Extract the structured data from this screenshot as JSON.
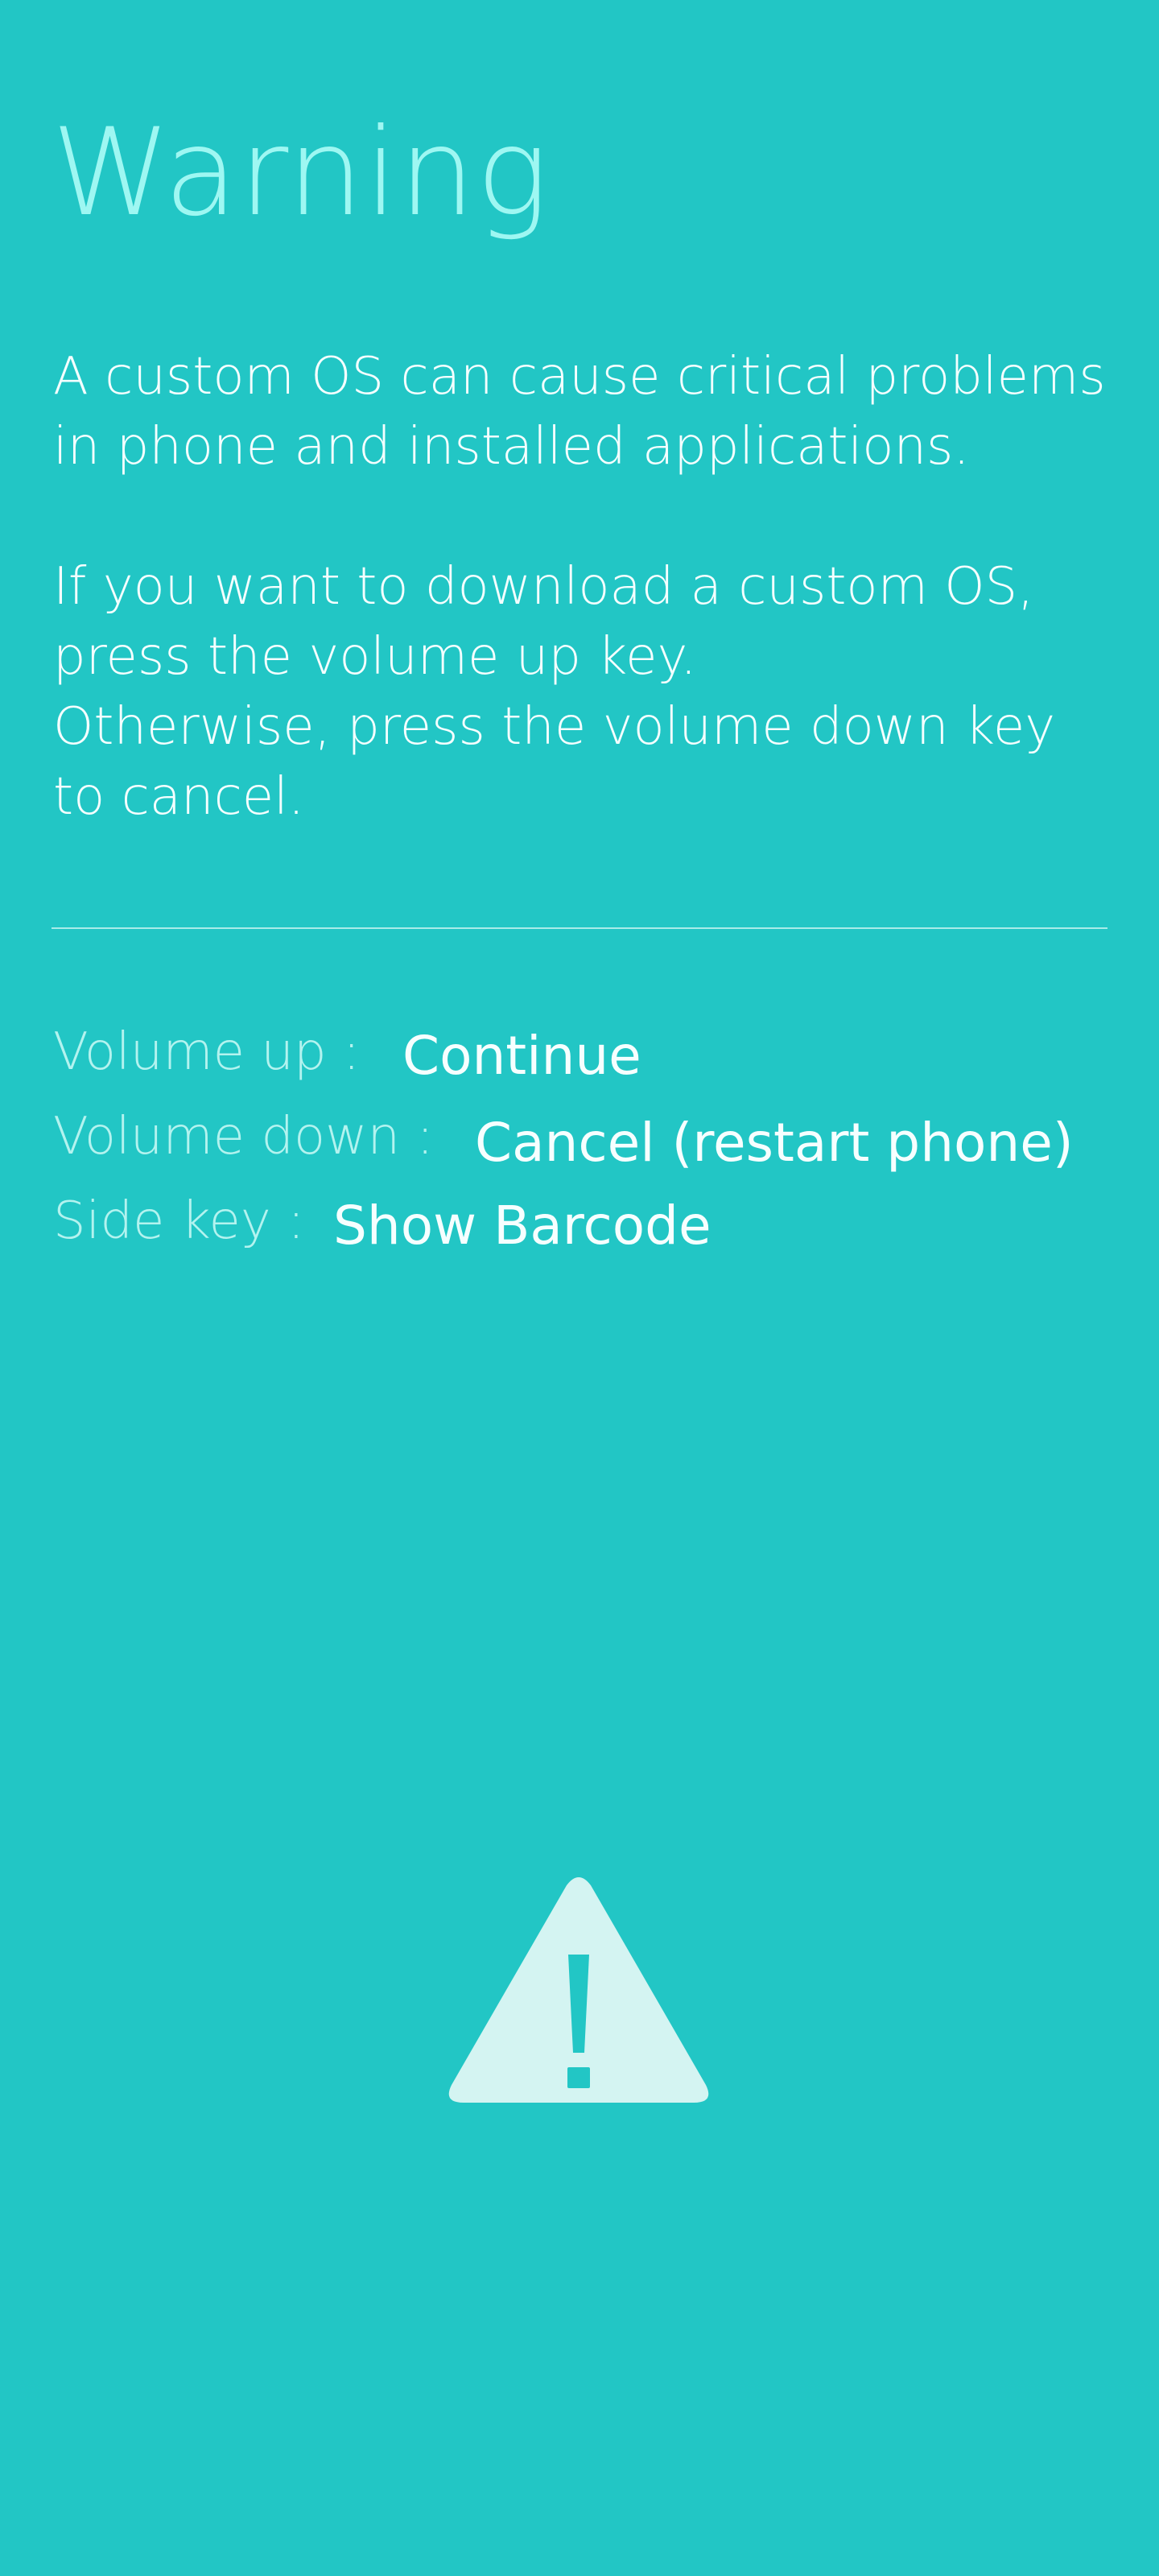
{
  "screen": {
    "title": "Warning",
    "body": {
      "paragraph1_line1": "A custom OS can cause critical problems",
      "paragraph1_line2": "in phone and installed applications.",
      "paragraph2_line1": "If you want to download a custom OS,",
      "paragraph2_line2": "press the volume up key.",
      "paragraph2_line3": "Otherwise, press the volume down key",
      "paragraph2_line4": "to cancel."
    },
    "keys": [
      {
        "label": "Volume up :",
        "action": "Continue"
      },
      {
        "label": "Volume down :",
        "action": "Cancel (restart phone)"
      },
      {
        "label": "Side key :",
        "action": "Show Barcode"
      }
    ],
    "icon": "warning-triangle-icon"
  },
  "colors": {
    "background": "#22c6c5",
    "title": "#9ef7f2",
    "text": "#f4ffff",
    "icon": "#d4f4f2"
  }
}
